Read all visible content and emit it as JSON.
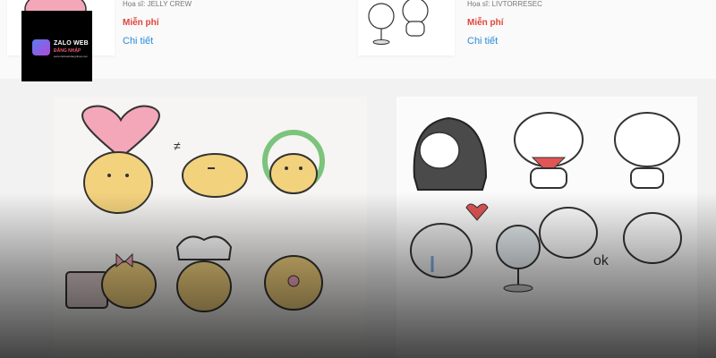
{
  "left_card": {
    "artist": "Họa sĩ: JELLY CREW",
    "price": "Miễn phí",
    "detail": "Chi tiết"
  },
  "right_card": {
    "artist": "Họa sĩ: LIVTORRESEC",
    "price": "Miễn phí",
    "detail": "Chi tiết"
  },
  "logo": {
    "title": "ZALO WEB",
    "subtitle": "ĐĂNG NHẬP",
    "tagline": "www.zalowebdangnhap.com"
  },
  "right_panel": {
    "ok_text": "ok"
  },
  "colors": {
    "price": "#e0443a",
    "link": "#2a8bd8",
    "heart": "#f4a7b9",
    "sticker_yellow": "#f3d27e"
  }
}
